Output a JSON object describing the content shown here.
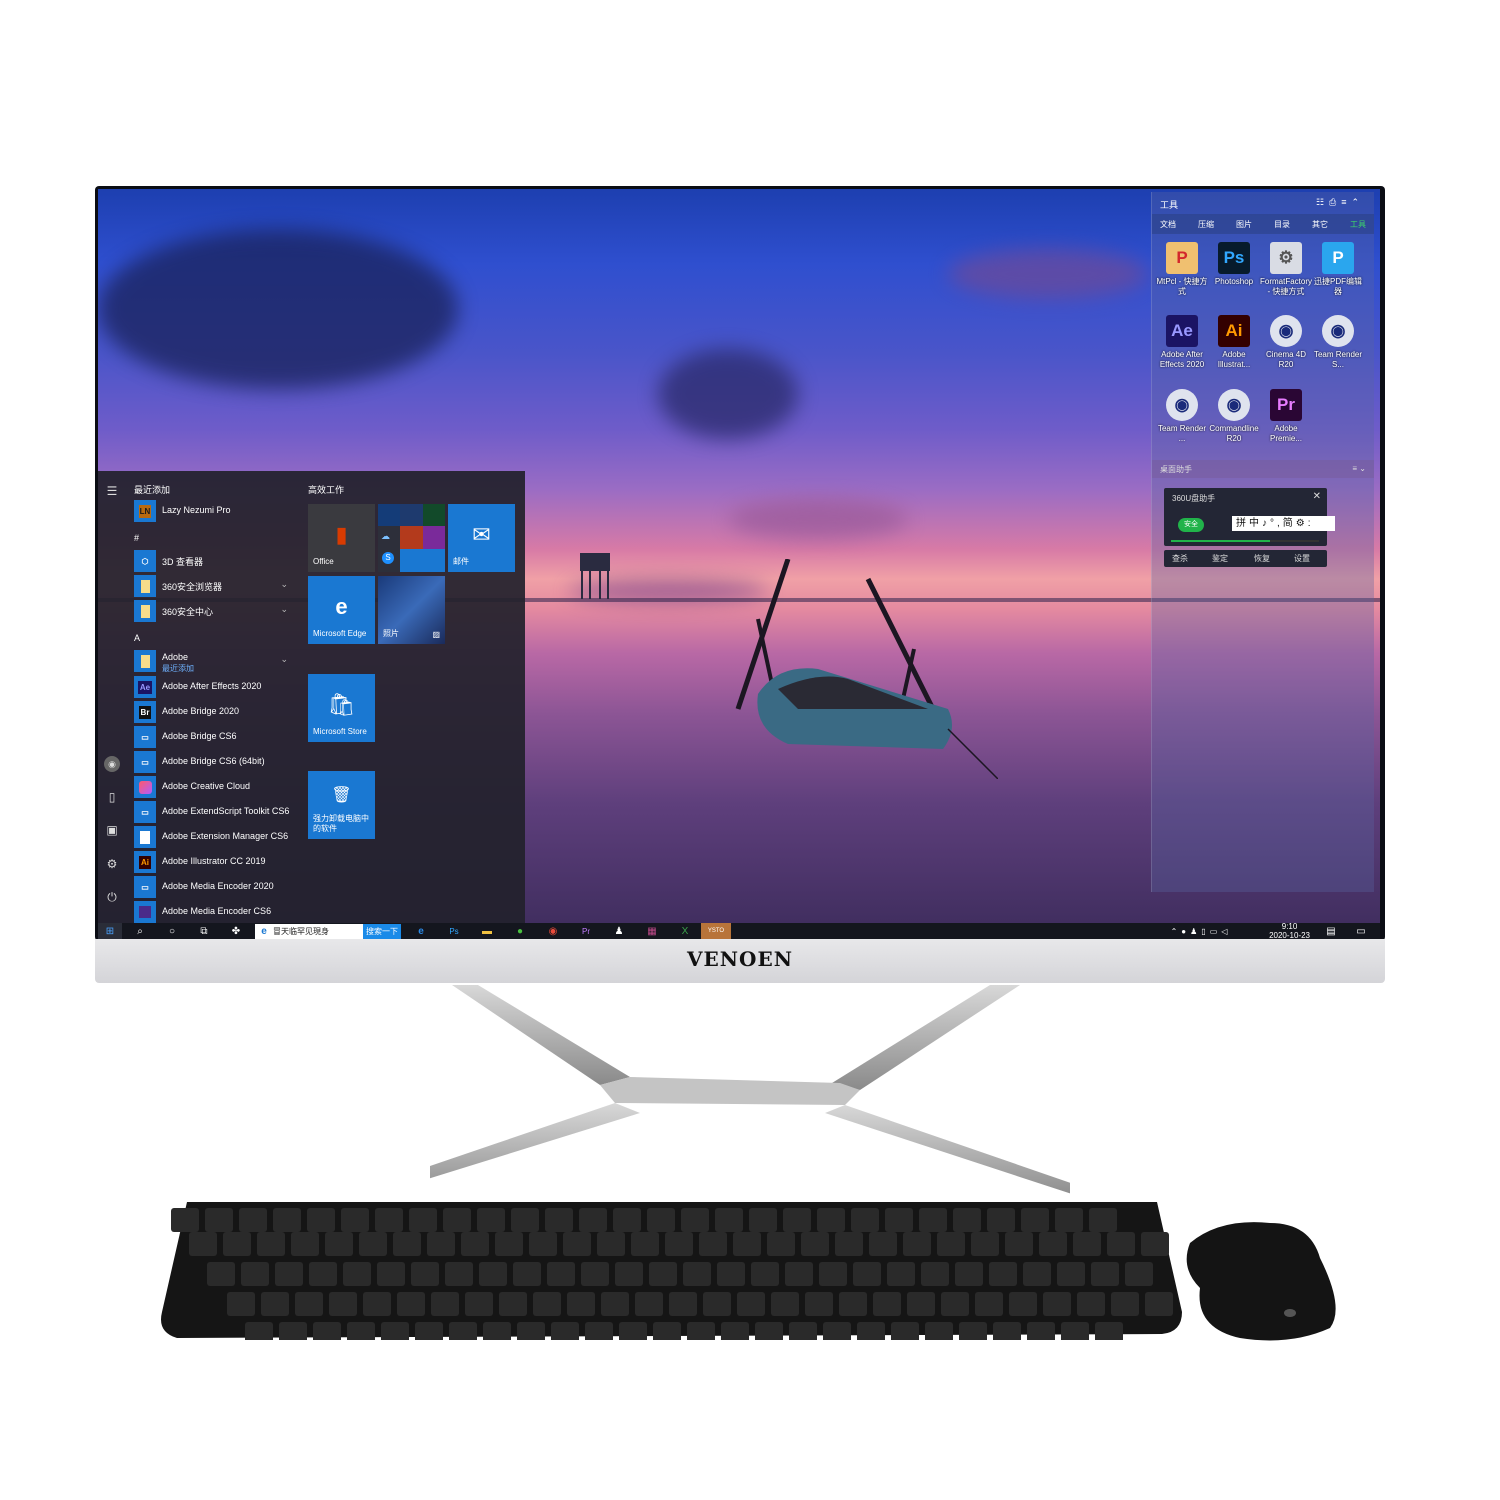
{
  "brand": "VENOEN",
  "start_menu": {
    "recent_header": "最近添加",
    "groups": [
      {
        "letter": "#"
      },
      {
        "letter": "A"
      }
    ],
    "apps": [
      {
        "label": "Lazy Nezumi Pro",
        "icon": "LN"
      },
      {
        "label": "3D 查看器",
        "icon": "cube-icon"
      },
      {
        "label": "360安全浏览器",
        "icon": "folder-icon",
        "expandable": true
      },
      {
        "label": "360安全中心",
        "icon": "folder-icon",
        "expandable": true
      },
      {
        "label": "Adobe",
        "sublabel": "最近添加",
        "icon": "folder-icon",
        "expandable": true
      },
      {
        "label": "Adobe After Effects 2020",
        "icon": "Ae"
      },
      {
        "label": "Adobe Bridge 2020",
        "icon": "Br"
      },
      {
        "label": "Adobe Bridge CS6",
        "icon": "app-icon"
      },
      {
        "label": "Adobe Bridge CS6 (64bit)",
        "icon": "app-icon"
      },
      {
        "label": "Adobe Creative Cloud",
        "icon": "cc-icon"
      },
      {
        "label": "Adobe ExtendScript Toolkit CS6",
        "icon": "app-icon"
      },
      {
        "label": "Adobe Extension Manager CS6",
        "icon": "file-icon"
      },
      {
        "label": "Adobe Illustrator CC 2019",
        "icon": "Ai"
      },
      {
        "label": "Adobe Media Encoder 2020",
        "icon": "app-icon"
      },
      {
        "label": "Adobe Media Encoder CS6",
        "icon": "me-icon"
      }
    ],
    "tile_group": "高效工作",
    "tiles": [
      {
        "label": "Office"
      },
      {
        "label": ""
      },
      {
        "label": "邮件"
      },
      {
        "label": "Microsoft Edge"
      },
      {
        "label": "照片"
      },
      {
        "label": "Microsoft Store"
      },
      {
        "label": "强力卸载电脑中的软件"
      }
    ],
    "rail": [
      "menu-icon",
      "user-icon",
      "documents-icon",
      "pictures-icon",
      "settings-icon",
      "power-icon"
    ]
  },
  "taskbar": {
    "search_text": "冒天临罕见現身",
    "search_button": "搜索一下",
    "pinned": [
      "edge",
      "photoshop",
      "file-explorer",
      "360-browser",
      "chrome",
      "premiere",
      "qq",
      "winrar",
      "excel",
      "ysto"
    ],
    "time": "9:10",
    "date": "2020-10-23"
  },
  "tools_panel": {
    "title": "工具",
    "tabs": [
      "文档",
      "压缩",
      "图片",
      "目录",
      "其它",
      "工具"
    ],
    "active_tab": "工具",
    "icons": [
      {
        "name": "MtPcl - 快捷方式",
        "glyph": "P",
        "bg": "#f0c070",
        "fg": "#d3272b"
      },
      {
        "name": "Photoshop",
        "glyph": "Ps",
        "bg": "#071b2c",
        "fg": "#31a8ff"
      },
      {
        "name": "FormatFactory - 快捷方式",
        "glyph": "⚙",
        "bg": "#d9dce4",
        "fg": "#555"
      },
      {
        "name": "迅捷PDF编辑器",
        "glyph": "P",
        "bg": "#2aa6ee",
        "fg": "#fff"
      },
      {
        "name": "Adobe After Effects 2020",
        "glyph": "Ae",
        "bg": "#1b1464",
        "fg": "#9999ff"
      },
      {
        "name": "Adobe Illustrat...",
        "glyph": "Ai",
        "bg": "#330000",
        "fg": "#ff9a00"
      },
      {
        "name": "Cinema 4D R20",
        "glyph": "◉",
        "bg": "#dfe3ee",
        "fg": "#1a2a7a"
      },
      {
        "name": "Team Render S...",
        "glyph": "◉",
        "bg": "#dfe3ee",
        "fg": "#1a2a7a"
      },
      {
        "name": "Team Render ...",
        "glyph": "◉",
        "bg": "#dfe3ee",
        "fg": "#1a2a7a"
      },
      {
        "name": "Commandline R20",
        "glyph": "◉",
        "bg": "#dfe3ee",
        "fg": "#1a2a7a"
      },
      {
        "name": "Adobe Premie...",
        "glyph": "Pr",
        "bg": "#2a0634",
        "fg": "#e77cff"
      }
    ],
    "helper_title": "桌面助手",
    "usb_widget": {
      "title": "360U盘助手",
      "status": "安全",
      "progress": 0.67,
      "ime_text": "拼中♪°,简⚙:",
      "actions": [
        "查杀",
        "鉴定",
        "恢复",
        "设置"
      ]
    }
  },
  "colors": {
    "accent": "#1a78d2",
    "taskbar": "#14161e",
    "safe_green": "#21b34a"
  }
}
